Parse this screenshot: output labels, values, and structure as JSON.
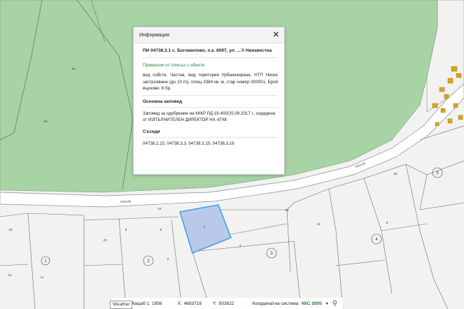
{
  "popup": {
    "title": "Информация",
    "close_label": "✕",
    "parcel_title": "ПИ 04738.3.1 с. Богомилово, п.к. 6097, ул. ...'// Неизвестна",
    "remove_link": "Премахни от списък с обекти",
    "description": "вид собств. Частна, вид територия Урбанизирана, НТП Ниско застрояване (до 10 m), площ 3384 кв. м, стар номер 003001, Брой върхове: 6 бр.",
    "order_title": "Основна заповед",
    "order_text": "Заповед за одобрение на КККР РД-18-400/25.09.2017 г., издадена от ИЗПЪЛНИТЕЛЕН ДИРЕКТОР НА АГКК",
    "neighbors_title": "Съседи",
    "neighbors_text": "04738.2.15, 04738.3.3, 04738.3.15, 04738.3.16"
  },
  "status_bar": {
    "scale_label": "Мащаб 1:",
    "scale_value": "1956",
    "x_label": "X:",
    "x_value": "4693719",
    "y_label": "Y:",
    "y_value": "503822",
    "crs_label": "Координатна система:",
    "crs_value": "ККС 2005",
    "weather_label": "Weather"
  },
  "map_labels": {
    "road_top": "5291190",
    "road_mid": "5291190",
    "parcel_numbers": [
      "10",
      "16",
      "1",
      "2",
      "3",
      "4",
      "3",
      "14",
      "15",
      "16",
      "5",
      "8",
      "18",
      "11",
      "21",
      "23"
    ],
    "circled": [
      "1",
      "2",
      "3",
      "3",
      "4"
    ]
  },
  "colors": {
    "forest": "#a7d3a5",
    "road": "#ffffff",
    "parcel_fill": "#b8c9ea",
    "parcel_stroke": "#3aa0e0",
    "building": "#e0a020",
    "accent": "#1a8a3a"
  }
}
